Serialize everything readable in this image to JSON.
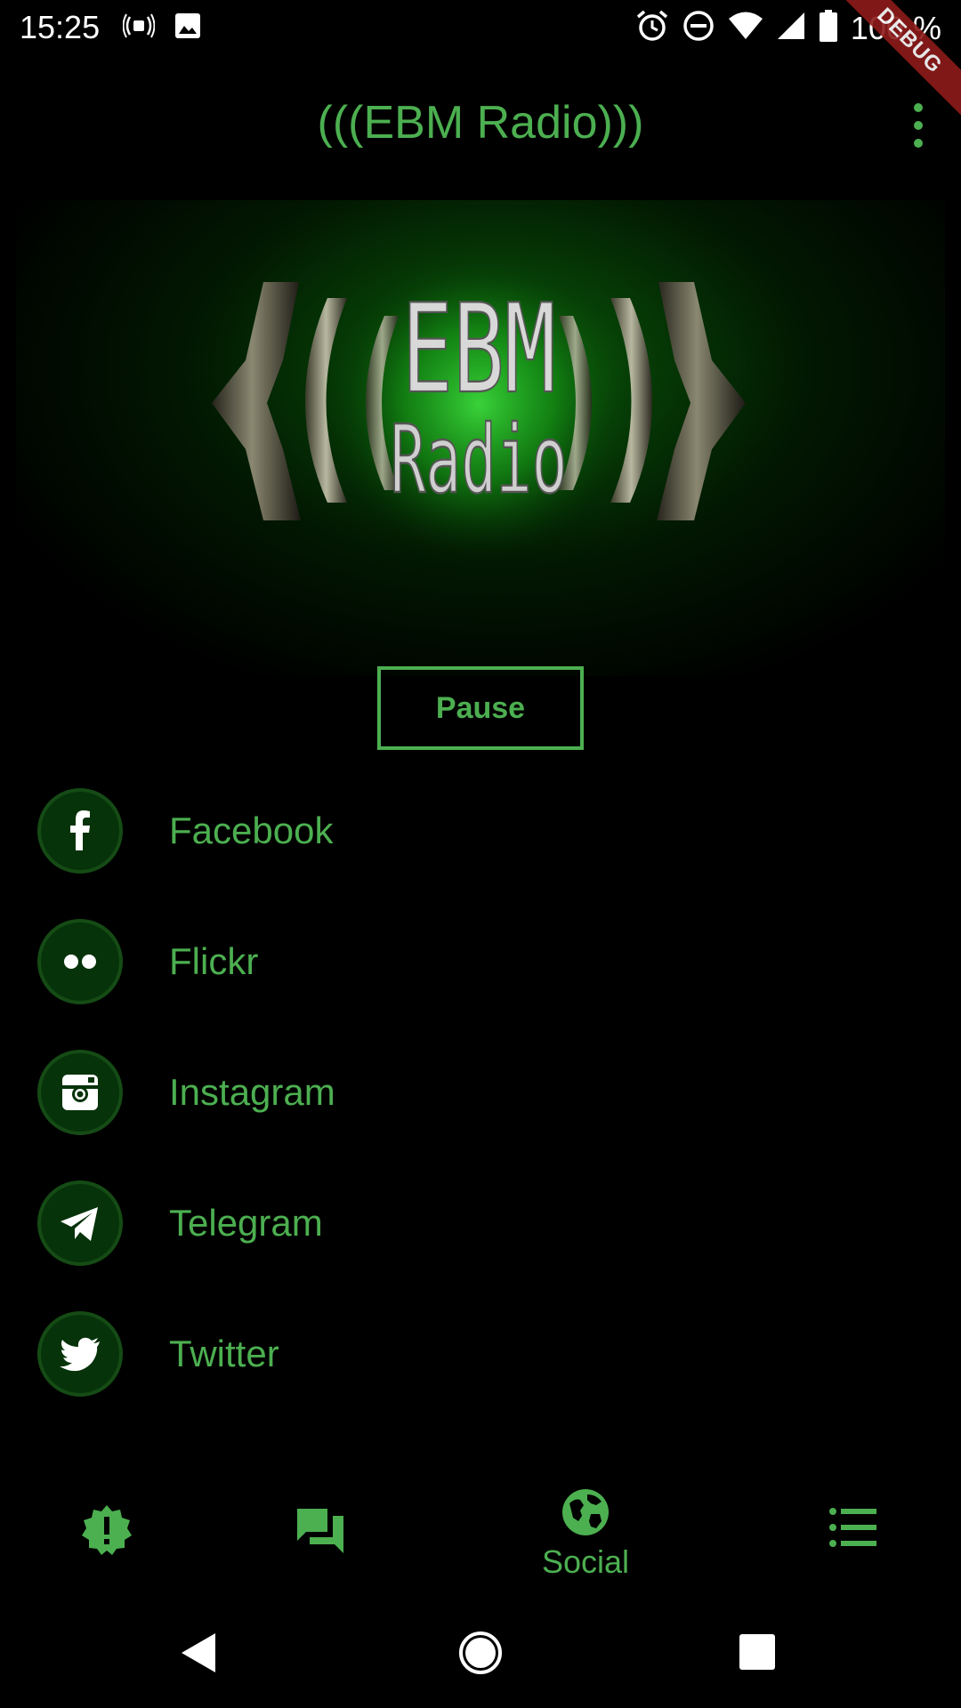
{
  "status_bar": {
    "time": "15:25",
    "battery_percent": "100 %",
    "icons": [
      "cast-icon",
      "image-icon",
      "alarm-icon",
      "do-not-disturb-icon",
      "wifi-icon",
      "signal-icon",
      "battery-icon"
    ]
  },
  "debug_banner": "DEBUG",
  "app_bar": {
    "title": "(((EBM Radio)))",
    "menu_icon": "more-vert-icon"
  },
  "logo": {
    "line1": "EBM",
    "line2": "Radio"
  },
  "player": {
    "pause_label": "Pause"
  },
  "social": {
    "items": [
      {
        "label": "Facebook",
        "icon": "facebook-icon"
      },
      {
        "label": "Flickr",
        "icon": "flickr-icon"
      },
      {
        "label": "Instagram",
        "icon": "instagram-icon"
      },
      {
        "label": "Telegram",
        "icon": "telegram-icon"
      },
      {
        "label": "Twitter",
        "icon": "twitter-icon"
      }
    ]
  },
  "bottom_nav": {
    "items": [
      {
        "icon": "alert-badge-icon",
        "label": ""
      },
      {
        "icon": "forum-icon",
        "label": ""
      },
      {
        "icon": "globe-icon",
        "label": "Social",
        "active": true
      },
      {
        "icon": "list-icon",
        "label": ""
      }
    ]
  },
  "colors": {
    "accent": "#4caf50",
    "background": "#000000",
    "icon_circle": "#06330a",
    "debug_ribbon": "#8e1b1b"
  }
}
